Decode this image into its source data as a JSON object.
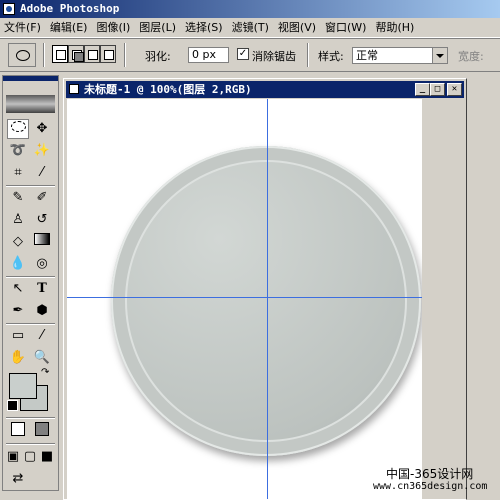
{
  "app": {
    "title": "Adobe Photoshop"
  },
  "menu": [
    "文件(F)",
    "编辑(E)",
    "图像(I)",
    "图层(L)",
    "选择(S)",
    "滤镜(T)",
    "视图(V)",
    "窗口(W)",
    "帮助(H)"
  ],
  "options": {
    "feather_label": "羽化:",
    "feather_value": "0 px",
    "antialias_label": "消除锯齿",
    "antialias_checked": "✓",
    "style_label": "样式:",
    "style_value": "正常",
    "width_label": "宽度:"
  },
  "document": {
    "title": "未标题-1 @ 100%(图层 2,RGB)"
  },
  "watermark": {
    "site_cn": "中国-365设计网",
    "url": "www.cn365design.com"
  },
  "colors": {
    "guide": "#3c6ee0",
    "title_active": "#0a246a",
    "plate": "#c4c9c6"
  }
}
